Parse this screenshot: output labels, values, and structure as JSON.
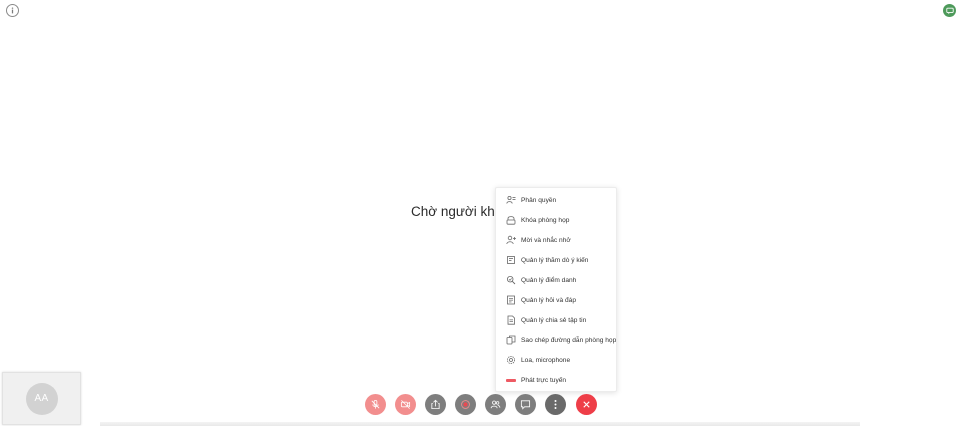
{
  "topbar": {
    "info_icon": "info-icon",
    "chat_icon": "chat-icon"
  },
  "main": {
    "waiting_text": "Chờ người khác"
  },
  "self_view": {
    "avatar_initials": "AA"
  },
  "more_menu": {
    "items": [
      {
        "label": "Phân quyền",
        "icon": "user-role-icon"
      },
      {
        "label": "Khóa phòng họp",
        "icon": "lock-icon"
      },
      {
        "label": "Mời và nhắc nhở",
        "icon": "add-user-icon"
      },
      {
        "label": "Quản lý thăm dò ý kiến",
        "icon": "poll-icon"
      },
      {
        "label": "Quản lý điểm danh",
        "icon": "attendance-icon"
      },
      {
        "label": "Quản lý hỏi và đáp",
        "icon": "qa-icon"
      },
      {
        "label": "Quản lý chia sẻ tập tin",
        "icon": "file-share-icon"
      },
      {
        "label": "Sao chép đường dẫn phòng họp",
        "icon": "copy-link-icon"
      },
      {
        "label": "Loa, microphone",
        "icon": "settings-icon"
      },
      {
        "label": "Phát trực tuyến",
        "icon": "live-stream-icon"
      }
    ]
  },
  "toolbar": {
    "buttons": [
      {
        "name": "microphone-off",
        "icon": "mic-off-icon",
        "color": "#f28e8e"
      },
      {
        "name": "camera-off",
        "icon": "camera-off-icon",
        "color": "#f28e8e"
      },
      {
        "name": "share-screen",
        "icon": "share-icon",
        "color": "#7e7e7e"
      },
      {
        "name": "record",
        "icon": "record-icon",
        "color": "#7e7e7e"
      },
      {
        "name": "participants",
        "icon": "people-icon",
        "color": "#7e7e7e"
      },
      {
        "name": "chat",
        "icon": "chat-bubble-icon",
        "color": "#7e7e7e"
      },
      {
        "name": "more-options",
        "icon": "more-vertical-icon",
        "color": "#6a6a6a"
      },
      {
        "name": "leave-meeting",
        "icon": "close-icon",
        "color": "#ee3e48"
      }
    ]
  },
  "colors": {
    "accent_green": "#4e9a5b",
    "danger_red": "#ee3e48",
    "muted_red": "#f28e8e",
    "live_red": "#ee5a63"
  }
}
